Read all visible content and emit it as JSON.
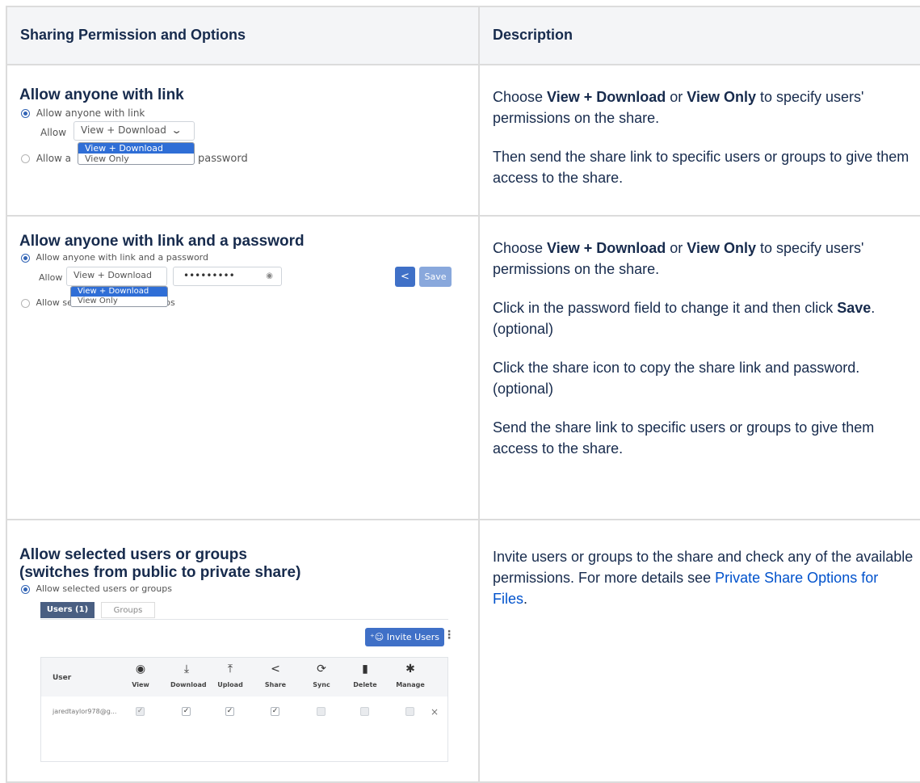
{
  "header": {
    "col1": "Sharing Permission and Options",
    "col2": "Description"
  },
  "row1": {
    "title": "Allow anyone with link",
    "shot": {
      "radio_label": "Allow anyone with link",
      "allow_label": "Allow",
      "select_value": "View + Download",
      "options": [
        "View + Download",
        "View Only"
      ],
      "radio2_left": "Allow a",
      "radio2_right": "password"
    },
    "desc": {
      "p1_pre": "Choose ",
      "p1_b1": "View + Download",
      "p1_mid": " or ",
      "p1_b2": "View Only",
      "p1_post": " to specify users' permissions on the share.",
      "p2": "Then send the share link to specific users or groups to give them access to the share."
    }
  },
  "row2": {
    "title": "Allow anyone with link and a password",
    "shot": {
      "radio_label": "Allow anyone with link and a password",
      "allow_label": "Allow",
      "select_value": "View + Download",
      "options": [
        "View + Download",
        "View Only"
      ],
      "password_value": "•••••••••",
      "save_label": "Save",
      "radio2_left": "Allow se",
      "radio2_right": "groups"
    },
    "desc": {
      "p1_pre": "Choose ",
      "p1_b1": "View + Download",
      "p1_mid": " or ",
      "p1_b2": "View Only",
      "p1_post": " to specify users' permissions on the share.",
      "p2_pre": "Click in the password field to change it and then click ",
      "p2_b": "Save",
      "p2_post": ". (optional)",
      "p3": "Click the share icon to copy the share link and password. (optional)",
      "p4": "Send the share link to specific users or groups to give them access to the share."
    }
  },
  "row3": {
    "title_line1": "Allow selected users or groups",
    "title_line2": "(switches from public to private share)",
    "shot": {
      "radio_label": "Allow selected users or groups",
      "tab_users": "Users (1)",
      "tab_groups": "Groups",
      "invite_label": "Invite Users",
      "col_user": "User",
      "perms": [
        "View",
        "Download",
        "Upload",
        "Share",
        "Sync",
        "Delete",
        "Manage"
      ],
      "user_email": "jaredtaylor978@g..."
    },
    "desc": {
      "text": "Invite users or groups to the share and check any of the available permissions. For more details see ",
      "link": "Private Share Options for Files",
      "end": "."
    }
  }
}
